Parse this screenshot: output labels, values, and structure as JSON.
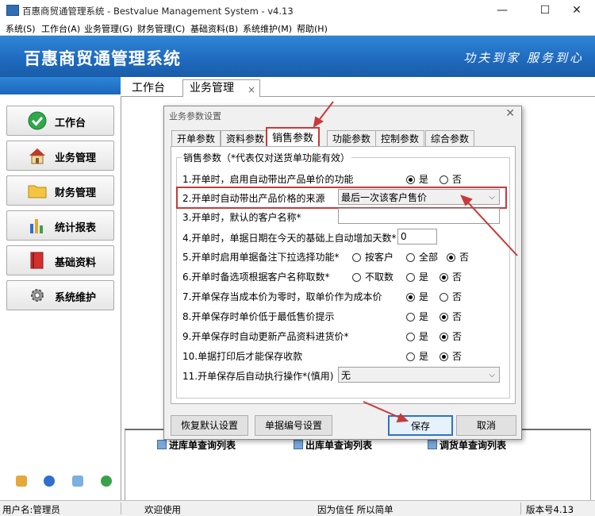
{
  "window": {
    "title": "百惠商贸通管理系统 - Bestvalue Management System - v4.13",
    "minimize": "—",
    "maximize": "☐",
    "close": "✕"
  },
  "menu": [
    "系统(S)",
    "工作台(A)",
    "业务管理(G)",
    "财务管理(C)",
    "基础资料(B)",
    "系统维护(M)",
    "帮助(H)"
  ],
  "banner": {
    "title": "百惠商贸通管理系统",
    "slogan": "功夫到家 服务到心"
  },
  "nav": [
    {
      "label": "工作台",
      "icon": "check-circle-icon"
    },
    {
      "label": "业务管理",
      "icon": "house-icon"
    },
    {
      "label": "财务管理",
      "icon": "folder-icon"
    },
    {
      "label": "统计报表",
      "icon": "bar-chart-icon"
    },
    {
      "label": "基础资料",
      "icon": "book-icon"
    },
    {
      "label": "系统维护",
      "icon": "gear-icon"
    }
  ],
  "main_tabs": [
    {
      "label": "工作台"
    },
    {
      "label": "业务管理",
      "close": "×"
    }
  ],
  "quick_links": [
    "进库单查询列表",
    "出库单查询列表",
    "调货单查询列表"
  ],
  "status": {
    "user": "用户名:管理员",
    "welcome": "欢迎使用",
    "motto": "因为信任 所以简单",
    "version": "版本号4.13"
  },
  "dialog": {
    "title": "业务参数设置",
    "close": "✕",
    "tabs": [
      "开单参数",
      "资料参数",
      "销售参数",
      "功能参数",
      "控制参数",
      "综合参数"
    ],
    "active_tab": 2,
    "group_title": "销售参数（*代表仅对送货单功能有效）",
    "rows": {
      "r1": {
        "label": "1.开单时，启用自动带出产品单价的功能",
        "opt_yes": "是",
        "opt_no": "否",
        "selected": "是"
      },
      "r2": {
        "label": "2.开单时自动带出产品价格的来源",
        "value": "最后一次该客户售价"
      },
      "r3": {
        "label": "3.开单时，默认的客户名称*",
        "value": ""
      },
      "r4": {
        "label": "4.开单时，单据日期在今天的基础上自动增加天数*",
        "value": "0"
      },
      "r5": {
        "label": "5.开单时启用单据备注下拉选择功能*",
        "opt_a": "按客户",
        "opt_b": "全部",
        "opt_c": "否",
        "selected": "否"
      },
      "r6": {
        "label": "6.开单时备选项根据客户名称取数*",
        "opt_a": "不取数",
        "opt_b": "是",
        "opt_c": "否",
        "selected": "否"
      },
      "r7": {
        "label": "7.开单保存当成本价为零时，取单价作为成本价",
        "opt_yes": "是",
        "opt_no": "否",
        "selected": "是"
      },
      "r8": {
        "label": "8.开单保存时单价低于最低售价提示",
        "opt_yes": "是",
        "opt_no": "否",
        "selected": "否"
      },
      "r9": {
        "label": "9.开单保存时自动更新产品资料进货价*",
        "opt_yes": "是",
        "opt_no": "否",
        "selected": "否"
      },
      "r10": {
        "label": "10.单据打印后才能保存收款",
        "opt_yes": "是",
        "opt_no": "否",
        "selected": "否"
      },
      "r11": {
        "label": "11.开单保存后自动执行操作*(慎用)",
        "value": "无"
      }
    },
    "buttons": {
      "restore": "恢复默认设置",
      "numbering": "单据编号设置",
      "save": "保存",
      "cancel": "取消"
    }
  },
  "colors": {
    "banner": "#1f6bc0",
    "highlight": "#c83a3a",
    "primary_border": "#2f72c4"
  }
}
